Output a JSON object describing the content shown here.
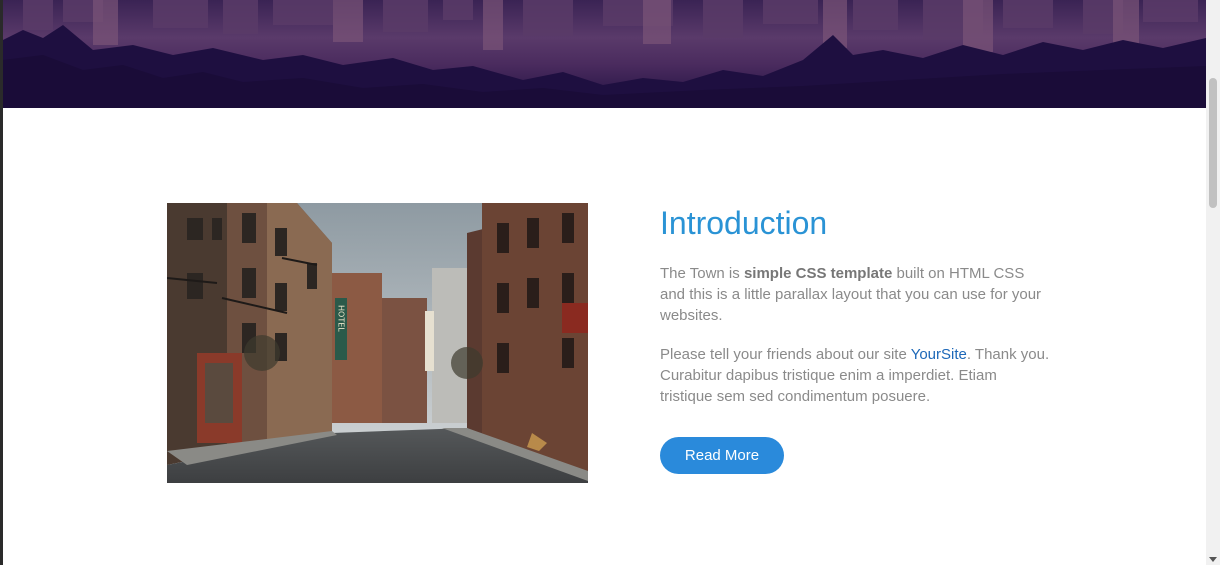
{
  "hero": {
    "image_name": "city-skyline-banner"
  },
  "main": {
    "image_name": "town-street-photo",
    "sign_hotel": "HOTEL",
    "title": "Introduction",
    "p1_start": "The Town is ",
    "p1_bold": "simple CSS template",
    "p1_end": " built on HTML CSS and this is a little parallax layout that you can use for your websites.",
    "p2_start": "Please tell your friends about our site ",
    "p2_link": "YourSite",
    "p2_end": ". Thank you. Curabitur dapibus tristique enim a imperdiet. Etiam tristique sem sed condimentum posuere.",
    "button_label": "Read More"
  },
  "colors": {
    "accent": "#2a93d5",
    "button": "#2a8adb",
    "link": "#1d68b8",
    "text": "#8a8a8a",
    "hero_dark": "#1e0f40"
  }
}
